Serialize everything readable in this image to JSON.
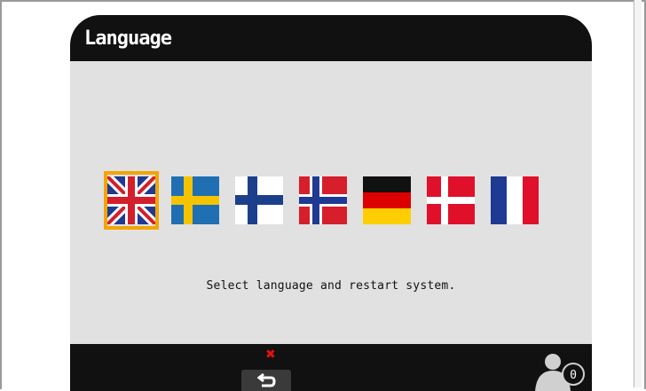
{
  "window": {
    "title": "Language"
  },
  "message": "Select language and restart system.",
  "flags": [
    {
      "name": "flag-uk-icon",
      "language": "English",
      "selected": true
    },
    {
      "name": "flag-sweden-icon",
      "language": "Swedish",
      "selected": false
    },
    {
      "name": "flag-finland-icon",
      "language": "Finnish",
      "selected": false
    },
    {
      "name": "flag-norway-icon",
      "language": "Norwegian",
      "selected": false
    },
    {
      "name": "flag-germany-icon",
      "language": "German",
      "selected": false
    },
    {
      "name": "flag-denmark-icon",
      "language": "Danish",
      "selected": false
    },
    {
      "name": "flag-france-icon",
      "language": "French",
      "selected": false
    }
  ],
  "footer": {
    "back_icon": "back-arrow-icon",
    "cancel_icon": "red-x-icon",
    "user_icon": "user-icon",
    "user_badge": "0"
  },
  "colors": {
    "selection_border": "#f4a400",
    "panel_background": "#e1e1e1",
    "frame": "#111111"
  }
}
